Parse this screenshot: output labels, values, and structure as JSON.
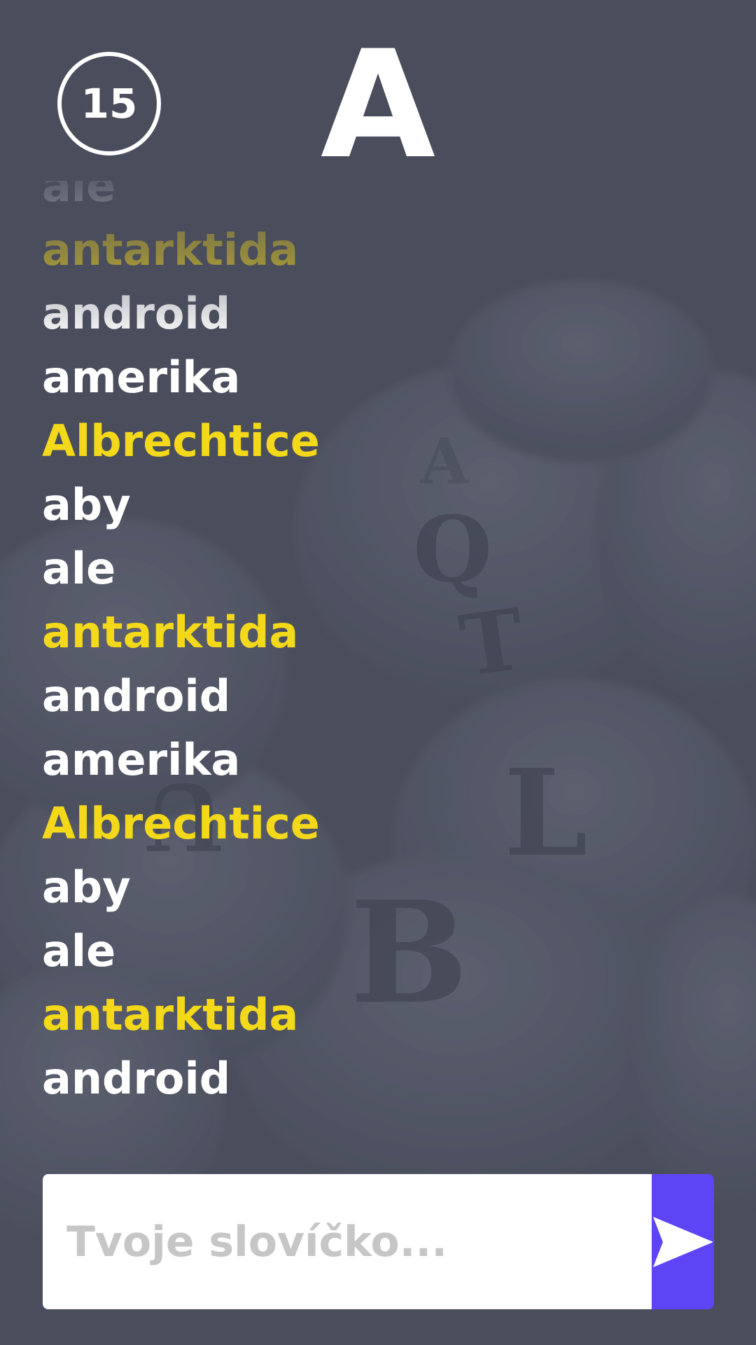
{
  "game": {
    "timer": "15",
    "letter": "A"
  },
  "words": [
    {
      "text": "ale",
      "highlight": false
    },
    {
      "text": "antarktida",
      "highlight": true
    },
    {
      "text": "android",
      "highlight": false
    },
    {
      "text": "amerika",
      "highlight": false
    },
    {
      "text": "Albrechtice",
      "highlight": true
    },
    {
      "text": "aby",
      "highlight": false
    },
    {
      "text": "ale",
      "highlight": false
    },
    {
      "text": "antarktida",
      "highlight": true
    },
    {
      "text": "android",
      "highlight": false
    },
    {
      "text": "amerika",
      "highlight": false
    },
    {
      "text": "Albrechtice",
      "highlight": true
    },
    {
      "text": "aby",
      "highlight": false
    },
    {
      "text": "ale",
      "highlight": false
    },
    {
      "text": "antarktida",
      "highlight": true
    },
    {
      "text": "android",
      "highlight": false
    }
  ],
  "input": {
    "placeholder": "Tvoje slovíčko...",
    "value": ""
  },
  "send_button": {
    "icon": "send-icon"
  },
  "colors": {
    "background": "#4a4e5c",
    "highlight": "#f4d81a",
    "text": "#ffffff",
    "accent": "#5d45f6",
    "placeholder": "#c6c6c6"
  }
}
